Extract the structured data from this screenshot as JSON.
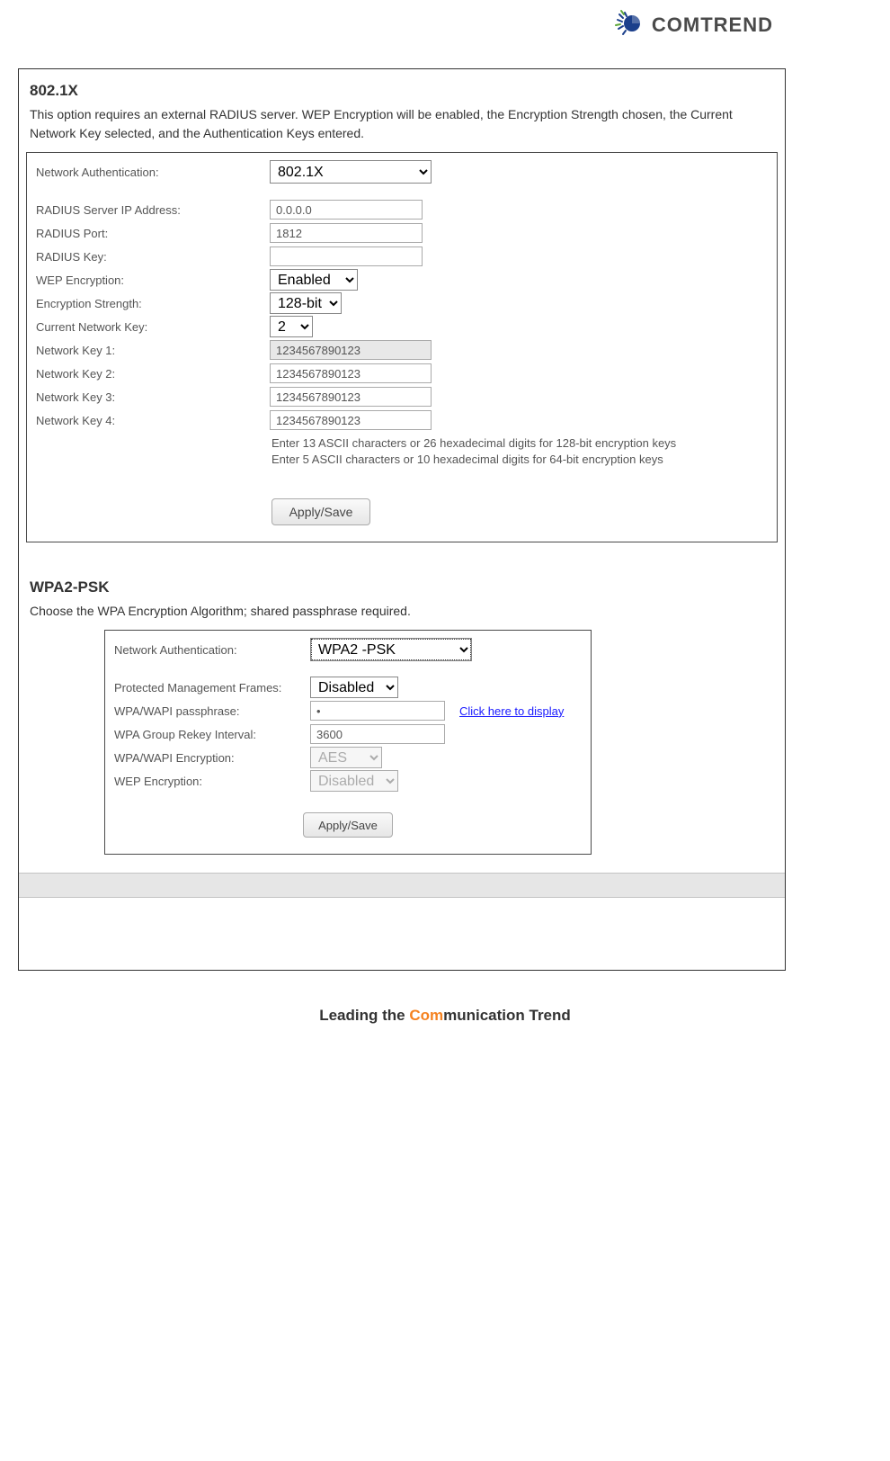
{
  "brand": "COMTREND",
  "section1": {
    "title": "802.1X",
    "panel1": {
      "rows": {
        "netauth_label": "Network Authentication:",
        "netauth_value": "802.1X",
        "radius_ip_label": "RADIUS Server IP Address:",
        "radius_ip_value": "0.0.0.0",
        "radius_port_label": "RADIUS Port:",
        "radius_port_value": "1812",
        "radius_key_label": "RADIUS Key:",
        "radius_key_value": "",
        "wep_label": "WEP Encryption:",
        "wep_value": "Enabled",
        "strength_label": "Encryption Strength:",
        "strength_value": "128-bit",
        "current_key_label": "Current Network Key:",
        "current_key_value": "2",
        "key1_label": "Network Key 1:",
        "key1_value": "1234567890123",
        "key2_label": "Network Key 2:",
        "key2_value": "1234567890123",
        "key3_label": "Network Key 3:",
        "key3_value": "1234567890123",
        "key4_label": "Network Key 4:",
        "key4_value": "1234567890123"
      },
      "hint_line1": "Enter 13 ASCII characters or 26 hexadecimal digits for 128-bit encryption keys",
      "hint_line2": "Enter 5 ASCII characters or 10 hexadecimal digits for 64-bit encryption keys",
      "apply_label": "Apply/Save"
    }
  },
  "section2": {
    "title": "WPA2-PSK",
    "panel2": {
      "rows": {
        "netauth_label": "Network Authentication:",
        "netauth_value": "WPA2 -PSK",
        "pmf_label": "Protected Management Frames:",
        "pmf_value": "Disabled",
        "passphrase_label": "WPA/WAPI passphrase:",
        "passphrase_value": "•",
        "passphrase_link": "Click here to display",
        "rekey_label": "WPA Group Rekey Interval:",
        "rekey_value": "3600",
        "enc_label": "WPA/WAPI Encryption:",
        "enc_value": "AES",
        "wep_label": "WEP Encryption:",
        "wep_value": "Disabled"
      },
      "apply_label": "Apply/Save"
    }
  },
  "desc_title": "",
  "footer": {
    "leading": "Leading the ",
    "com": "Com",
    "munication": "munication ",
    "trend": "Trend"
  },
  "page_num": ""
}
